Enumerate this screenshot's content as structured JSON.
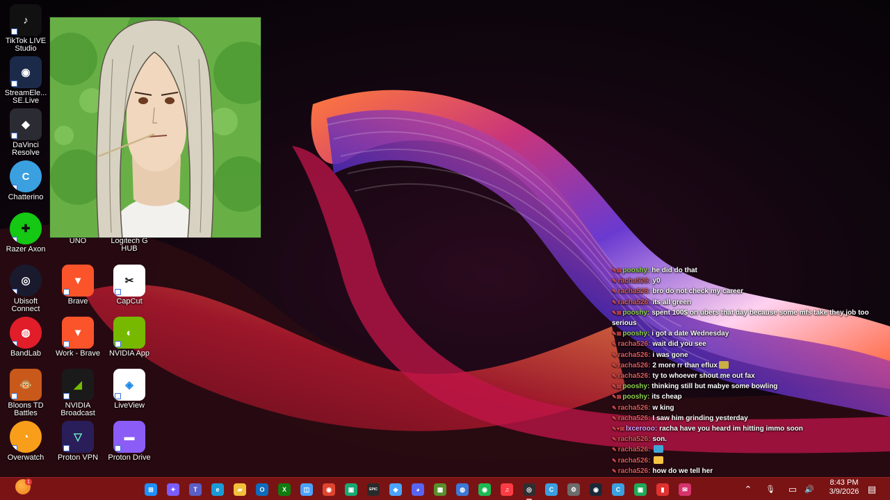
{
  "desktop": {
    "icons": [
      {
        "label": "TikTok LIVE Studio",
        "glyph": "♪",
        "color": "#111111"
      },
      {
        "label": "StreamEle... SE.Live",
        "glyph": "◉",
        "color": "#1c2a4a"
      },
      {
        "label": "DaVinci Resolve",
        "glyph": "◆",
        "color": "#2b2b33"
      },
      {
        "label": "Chatterino",
        "glyph": "C",
        "color": "#3aa0e0"
      },
      {
        "label": "Razer Axon",
        "glyph": "✚",
        "color": "#14c814"
      },
      {
        "label": "UNO",
        "glyph": "",
        "color": "transparent"
      },
      {
        "label": "Logitech G HUB",
        "glyph": "",
        "color": "transparent"
      },
      {
        "label": "Ubisoft Connect",
        "glyph": "◎",
        "color": "#1a1a2e"
      },
      {
        "label": "Brave",
        "glyph": "▼",
        "color": "#fb542b"
      },
      {
        "label": "CapCut",
        "glyph": "✂",
        "color": "#111111"
      },
      {
        "label": "BandLab",
        "glyph": "◍",
        "color": "#e11d2a"
      },
      {
        "label": "Work - Brave",
        "glyph": "▼",
        "color": "#fb542b"
      },
      {
        "label": "NVIDIA App",
        "glyph": "◐",
        "color": "#76b900"
      },
      {
        "label": "Bloons TD Battles",
        "glyph": "🐵",
        "color": "#c8591b"
      },
      {
        "label": "NVIDIA Broadcast",
        "glyph": "◢",
        "color": "#1a1a1a"
      },
      {
        "label": "LiveView",
        "glyph": "◈",
        "color": "#ffffff"
      },
      {
        "label": "Overwatch",
        "glyph": "◔",
        "color": "#f99e1a"
      },
      {
        "label": "Proton VPN",
        "glyph": "▽",
        "color": "#2a1e5a"
      },
      {
        "label": "Proton Drive",
        "glyph": "▬",
        "color": "#8b5cf6"
      }
    ]
  },
  "chat": {
    "messages": [
      {
        "badge": "✎⊠",
        "user": "pooshy:",
        "user_color": "#8fd14f",
        "text": "he did do that"
      },
      {
        "badge": "✎",
        "user": "racha526:",
        "user_color": "#e05a5a",
        "text": "y0"
      },
      {
        "badge": "✎",
        "user": "racha526:",
        "user_color": "#e05a5a",
        "text": "bro do not check my career"
      },
      {
        "badge": "✎",
        "user": "racha526:",
        "user_color": "#e05a5a",
        "text": "its all green"
      },
      {
        "badge": "✎⊠",
        "user": "pooshy:",
        "user_color": "#8fd14f",
        "text": "spent 100$ on ubers that day because some mfs take they job too serious"
      },
      {
        "badge": "✎⊠",
        "user": "pooshy:",
        "user_color": "#8fd14f",
        "text": "i got a date Wednesday"
      },
      {
        "badge": "✎",
        "user": "racha526:",
        "user_color": "#e05a5a",
        "text": "wait did you see"
      },
      {
        "badge": "✎",
        "user": "racha526:",
        "user_color": "#e05a5a",
        "text": "i was gone"
      },
      {
        "badge": "✎",
        "user": "racha526:",
        "user_color": "#e05a5a",
        "text": "2 more rr than eflux",
        "emote": "#c8b043"
      },
      {
        "badge": "✎",
        "user": "racha526:",
        "user_color": "#e05a5a",
        "text": "ty to whoever shout me out fax"
      },
      {
        "badge": "✎⊠",
        "user": "pooshy:",
        "user_color": "#8fd14f",
        "text": "thinking still but mabye some bowling"
      },
      {
        "badge": "✎⊠",
        "user": "pooshy:",
        "user_color": "#8fd14f",
        "text": "its cheap"
      },
      {
        "badge": "✎",
        "user": "racha526:",
        "user_color": "#e05a5a",
        "text": "w king"
      },
      {
        "badge": "✎",
        "user": "racha526:",
        "user_color": "#e05a5a",
        "text": "I saw him grinding yesterday"
      },
      {
        "badge": "✎♥⊠",
        "user": "lxcerooo:",
        "user_color": "#d8a6ff",
        "text": "racha have you heard im hitting immo soon"
      },
      {
        "badge": "✎",
        "user": "racha526:",
        "user_color": "#e05a5a",
        "text": "son."
      },
      {
        "badge": "✎",
        "user": "racha526:",
        "user_color": "#e05a5a",
        "text": "",
        "emote": "#3fa7d6"
      },
      {
        "badge": "✎",
        "user": "racha526:",
        "user_color": "#e05a5a",
        "text": "",
        "emote": "#f5c542"
      },
      {
        "badge": "✎",
        "user": "racha526:",
        "user_color": "#e05a5a",
        "text": "how do we tell her"
      }
    ]
  },
  "taskbar": {
    "apps": [
      {
        "name": "start",
        "glyph": "⊞",
        "color": "#1e90ff"
      },
      {
        "name": "copilot",
        "glyph": "✦",
        "color": "#7b5cff"
      },
      {
        "name": "teams",
        "glyph": "T",
        "color": "#5b5fc7"
      },
      {
        "name": "edge",
        "glyph": "e",
        "color": "#1a9bd7"
      },
      {
        "name": "file-explorer",
        "glyph": "▰",
        "color": "#f3c03b"
      },
      {
        "name": "outlook",
        "glyph": "O",
        "color": "#0f6cbd"
      },
      {
        "name": "xbox",
        "glyph": "X",
        "color": "#107c10"
      },
      {
        "name": "store",
        "glyph": "◫",
        "color": "#4aa3ff"
      },
      {
        "name": "chrome",
        "glyph": "◉",
        "color": "#e0452f"
      },
      {
        "name": "game-app",
        "glyph": "▣",
        "color": "#19a974"
      },
      {
        "name": "epic-games",
        "glyph": "EPIC",
        "color": "#2a2a2a"
      },
      {
        "name": "riot",
        "glyph": "◆",
        "color": "#4aa3ff"
      },
      {
        "name": "discord",
        "glyph": "◕",
        "color": "#5865f2"
      },
      {
        "name": "minecraft",
        "glyph": "▦",
        "color": "#5a8f2f"
      },
      {
        "name": "generic-app",
        "glyph": "◍",
        "color": "#3c78d8"
      },
      {
        "name": "spotify",
        "glyph": "◉",
        "color": "#1db954"
      },
      {
        "name": "music",
        "glyph": "♫",
        "color": "#fc3c44"
      },
      {
        "name": "obs",
        "glyph": "◎",
        "color": "#302e31"
      },
      {
        "name": "chatterino",
        "glyph": "C",
        "color": "#3aa0e0"
      },
      {
        "name": "settings",
        "glyph": "⚙",
        "color": "#6c6c6c"
      },
      {
        "name": "steam",
        "glyph": "◉",
        "color": "#1b2838"
      },
      {
        "name": "chatterino-2",
        "glyph": "C",
        "color": "#3aa0e0"
      },
      {
        "name": "green-app",
        "glyph": "▣",
        "color": "#1faa59"
      },
      {
        "name": "red-app",
        "glyph": "▮",
        "color": "#e03131"
      },
      {
        "name": "mail-app",
        "glyph": "✉",
        "color": "#d6336c"
      }
    ],
    "tray": {
      "chevron": "⌃",
      "mic": "🎙",
      "network": "▭",
      "volume": "🔊",
      "notification": "▤"
    },
    "clock": {
      "time": "8:43 PM",
      "date": "3/9/2026"
    },
    "weather_badge": "1"
  }
}
